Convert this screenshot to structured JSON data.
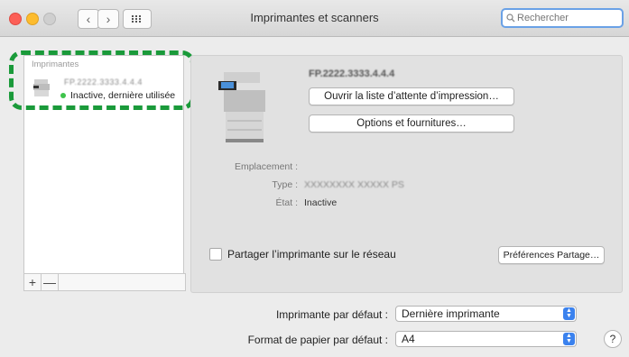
{
  "window": {
    "title": "Imprimantes et scanners"
  },
  "search": {
    "placeholder": "Rechercher"
  },
  "sidebar": {
    "header": "Imprimantes",
    "printers": [
      {
        "name": "FP.2222.3333.4.4.4",
        "status": "Inactive, dernière utilisée",
        "status_color": "#3ec34b"
      }
    ],
    "add_symbol": "+",
    "remove_symbol": "—"
  },
  "detail": {
    "printer_name": "FP.2222.3333.4.4.4",
    "open_queue_label": "Ouvrir la liste d’attente d’impression…",
    "options_label": "Options et fournitures…",
    "location_label": "Emplacement :",
    "location_value": "",
    "type_label": "Type :",
    "type_value": "XXXXXXXX XXXXX PS",
    "state_label": "État :",
    "state_value": "Inactive",
    "share_label": "Partager l’imprimante sur le réseau",
    "share_checked": false,
    "sharing_prefs_label": "Préférences Partage…"
  },
  "defaults": {
    "default_printer_label": "Imprimante par défaut :",
    "default_printer_value": "Dernière imprimante",
    "paper_label": "Format de papier par défaut :",
    "paper_value": "A4"
  },
  "colors": {
    "highlight": "#1a9a3a",
    "accent": "#3b82ee",
    "search_ring": "#6aa1e6"
  }
}
